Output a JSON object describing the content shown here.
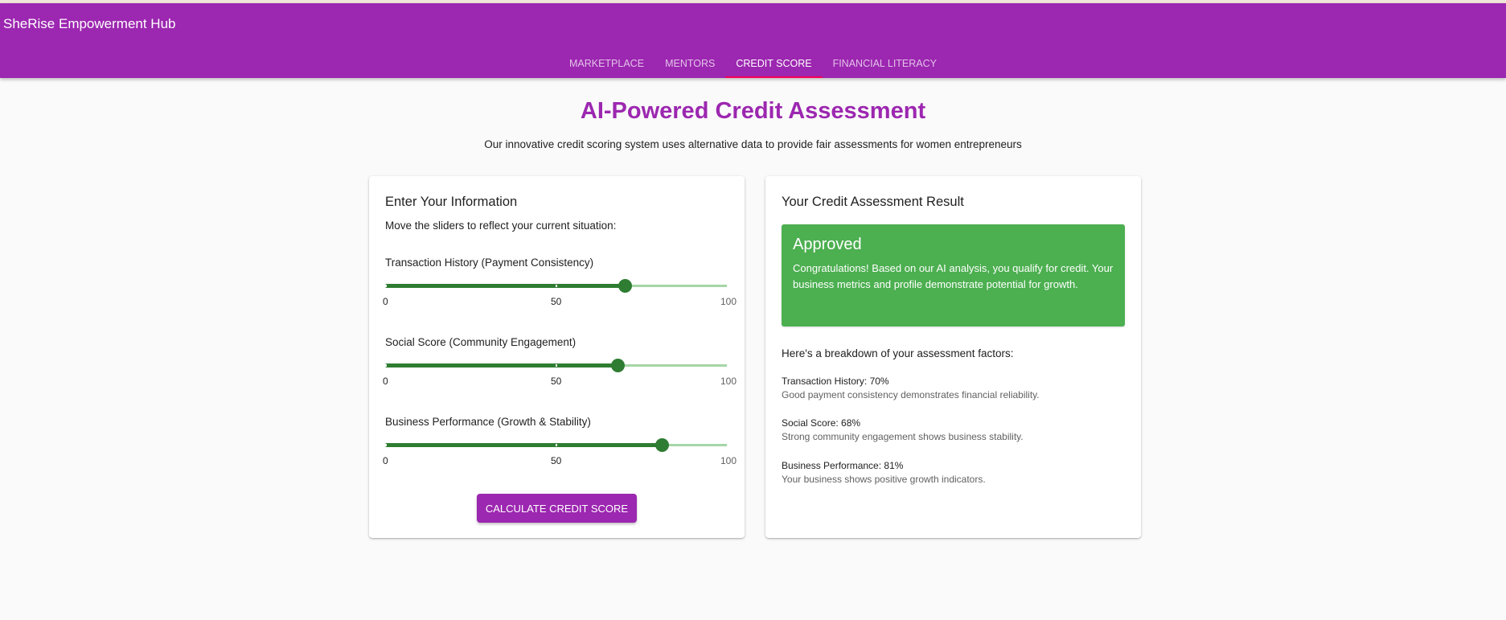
{
  "app": {
    "title": "SheRise Empowerment Hub"
  },
  "nav": {
    "tabs": [
      {
        "label": "MARKETPLACE",
        "active": false
      },
      {
        "label": "MENTORS",
        "active": false
      },
      {
        "label": "CREDIT SCORE",
        "active": true
      },
      {
        "label": "FINANCIAL LITERACY",
        "active": false
      }
    ]
  },
  "hero": {
    "title": "AI-Powered Credit Assessment",
    "subtitle": "Our innovative credit scoring system uses alternative data to provide fair assessments for women entrepreneurs"
  },
  "form": {
    "title": "Enter Your Information",
    "description": "Move the sliders to reflect your current situation:",
    "sliders": [
      {
        "label": "Transaction History (Payment Consistency)",
        "value": 70,
        "min": 0,
        "max": 100,
        "ticks": [
          "0",
          "50",
          "100"
        ]
      },
      {
        "label": "Social Score (Community Engagement)",
        "value": 68,
        "min": 0,
        "max": 100,
        "ticks": [
          "0",
          "50",
          "100"
        ]
      },
      {
        "label": "Business Performance (Growth & Stability)",
        "value": 81,
        "min": 0,
        "max": 100,
        "ticks": [
          "0",
          "50",
          "100"
        ]
      }
    ],
    "button_label": "CALCULATE CREDIT SCORE"
  },
  "result": {
    "title": "Your Credit Assessment Result",
    "status": "Approved",
    "message": "Congratulations! Based on our AI analysis, you qualify for credit. Your business metrics and profile demonstrate potential for growth.",
    "breakdown_intro": "Here's a breakdown of your assessment factors:",
    "factors": [
      {
        "title": "Transaction History: 70%",
        "description": "Good payment consistency demonstrates financial reliability."
      },
      {
        "title": "Social Score: 68%",
        "description": "Strong community engagement shows business stability."
      },
      {
        "title": "Business Performance: 81%",
        "description": "Your business shows positive growth indicators."
      }
    ]
  },
  "colors": {
    "primary": "#9c27b0",
    "tab_indicator": "#f50057",
    "slider_active": "#2e7d32",
    "slider_rail": "#a5d6a7",
    "approved_bg": "#4caf50",
    "page_bg": "#fafafa"
  }
}
